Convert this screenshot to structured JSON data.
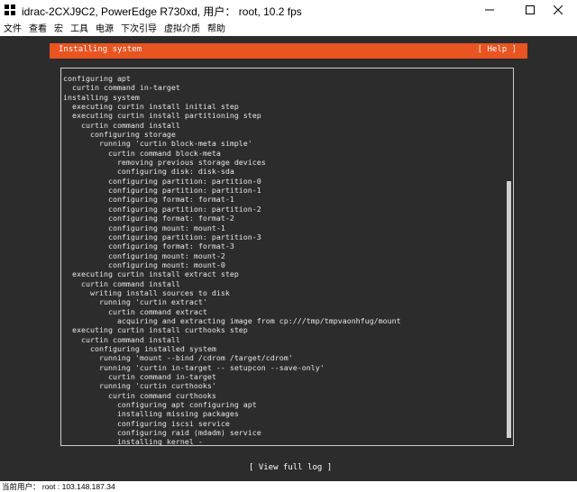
{
  "window": {
    "title": "idrac-2CXJ9C2, PowerEdge R730xd, 用户： root, 10.2 fps",
    "controls": {
      "minimize": "—",
      "maximize": "☐",
      "close": "✕"
    }
  },
  "menu": [
    "文件",
    "查看",
    "宏",
    "工具",
    "电源",
    "下次引导",
    "虚拟介质",
    "帮助"
  ],
  "header": {
    "title": "Installing system",
    "help": "[ Help ]"
  },
  "log": [
    "configuring apt",
    "  curtin command in-target",
    "installing system",
    "  executing curtin install initial step",
    "  executing curtin install partitioning step",
    "    curtin command install",
    "      configuring storage",
    "        running 'curtin block-meta simple'",
    "          curtin command block-meta",
    "            removing previous storage devices",
    "            configuring disk: disk-sda",
    "          configuring partition: partition-0",
    "          configuring partition: partition-1",
    "          configuring format: format-1",
    "          configuring partition: partition-2",
    "          configuring format: format-2",
    "          configuring mount: mount-1",
    "          configuring partition: partition-3",
    "          configuring format: format-3",
    "          configuring mount: mount-2",
    "          configuring mount: mount-0",
    "  executing curtin install extract step",
    "    curtin command install",
    "      writing install sources to disk",
    "        running 'curtin extract'",
    "          curtin command extract",
    "            acquiring and extracting image from cp:///tmp/tmpvaonhfug/mount",
    "  executing curtin install curthooks step",
    "    curtin command install",
    "      configuring installed system",
    "        running 'mount --bind /cdrom /target/cdrom'",
    "        running 'curtin in-target -- setupcon --save-only'",
    "          curtin command in-target",
    "        running 'curtin curthooks'",
    "          curtin command curthooks",
    "            configuring apt configuring apt",
    "            installing missing packages",
    "            configuring iscsi service",
    "            configuring raid (mdadm) service",
    "            installing kernel -"
  ],
  "footer": {
    "view_log": "[ View full log ]"
  },
  "status": {
    "text": "当前用户： root : 103.148.187.34"
  },
  "colors": {
    "accent": "#e95420",
    "console_bg": "#2c2c2c",
    "text": "#e6e6e6"
  }
}
